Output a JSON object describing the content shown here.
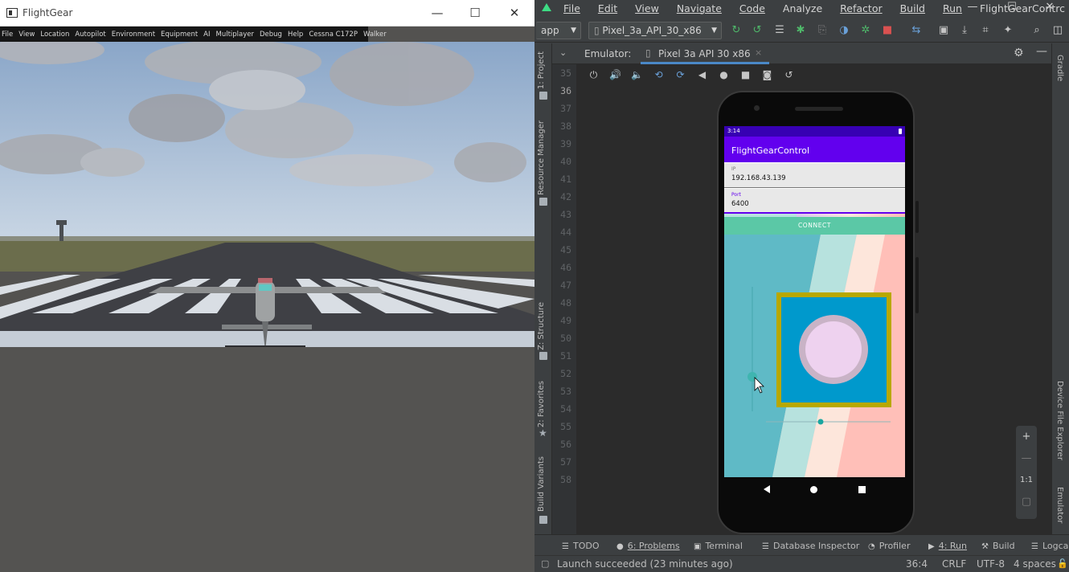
{
  "flightgear": {
    "title": "FlightGear",
    "window_controls": {
      "minimize": "—",
      "maximize": "☐",
      "close": "✕"
    },
    "menu": [
      "File",
      "View",
      "Location",
      "Autopilot",
      "Environment",
      "Equipment",
      "AI",
      "Multiplayer",
      "Debug",
      "Help",
      "Cessna C172P",
      "Walker"
    ]
  },
  "studio": {
    "menu": [
      "File",
      "Edit",
      "View",
      "Navigate",
      "Code",
      "Analyze",
      "Refactor",
      "Build",
      "Run"
    ],
    "project_name": "FlightGearContrc",
    "toolbar": {
      "module": "app",
      "device": "Pixel_3a_API_30_x86"
    },
    "left_tabs": [
      "1: Project",
      "Resource Manager",
      "Z: Structure",
      "2: Favorites",
      "Build Variants"
    ],
    "right_tabs": [
      "Gradle",
      "Device File Explorer",
      "Emulator"
    ],
    "emulator_label": "Emulator:",
    "emulator_tab": "Pixel 3a API 30 x86",
    "line_numbers": [
      "35",
      "36",
      "37",
      "38",
      "39",
      "40",
      "41",
      "42",
      "43",
      "44",
      "45",
      "46",
      "47",
      "48",
      "49",
      "50",
      "51",
      "52",
      "53",
      "54",
      "55",
      "56",
      "57",
      "58"
    ],
    "zoom": {
      "plus": "+",
      "minus": "—",
      "ratio": "1:1"
    },
    "bottom_tabs": [
      {
        "label": "TODO",
        "icon": "☰"
      },
      {
        "label": "6: Problems",
        "icon": "●"
      },
      {
        "label": "Terminal",
        "icon": "▣"
      },
      {
        "label": "Database Inspector",
        "icon": "☰"
      },
      {
        "label": "Profiler",
        "icon": "◔"
      },
      {
        "label": "4: Run",
        "icon": "▶"
      },
      {
        "label": "Build",
        "icon": "⚒"
      },
      {
        "label": "Logca",
        "icon": "☰"
      }
    ],
    "status": {
      "message": "Launch succeeded (23 minutes ago)",
      "position": "36:4",
      "line_sep": "CRLF",
      "encoding": "UTF-8",
      "indent": "4 spaces"
    }
  },
  "phone": {
    "time": "3:14",
    "app_title": "FlightGearControl",
    "ip": {
      "label": "IP",
      "value": "192.168.43.139"
    },
    "port": {
      "label": "Port",
      "value": "6400"
    },
    "connect_label": "CONNECT",
    "colors": {
      "appbar": "#6200ee",
      "status": "#3700b3",
      "connect": "#5bc8a6",
      "joystick_frame": "#b8a800",
      "joystick_bg": "#0099cc",
      "knob": "#eed2ef"
    }
  }
}
